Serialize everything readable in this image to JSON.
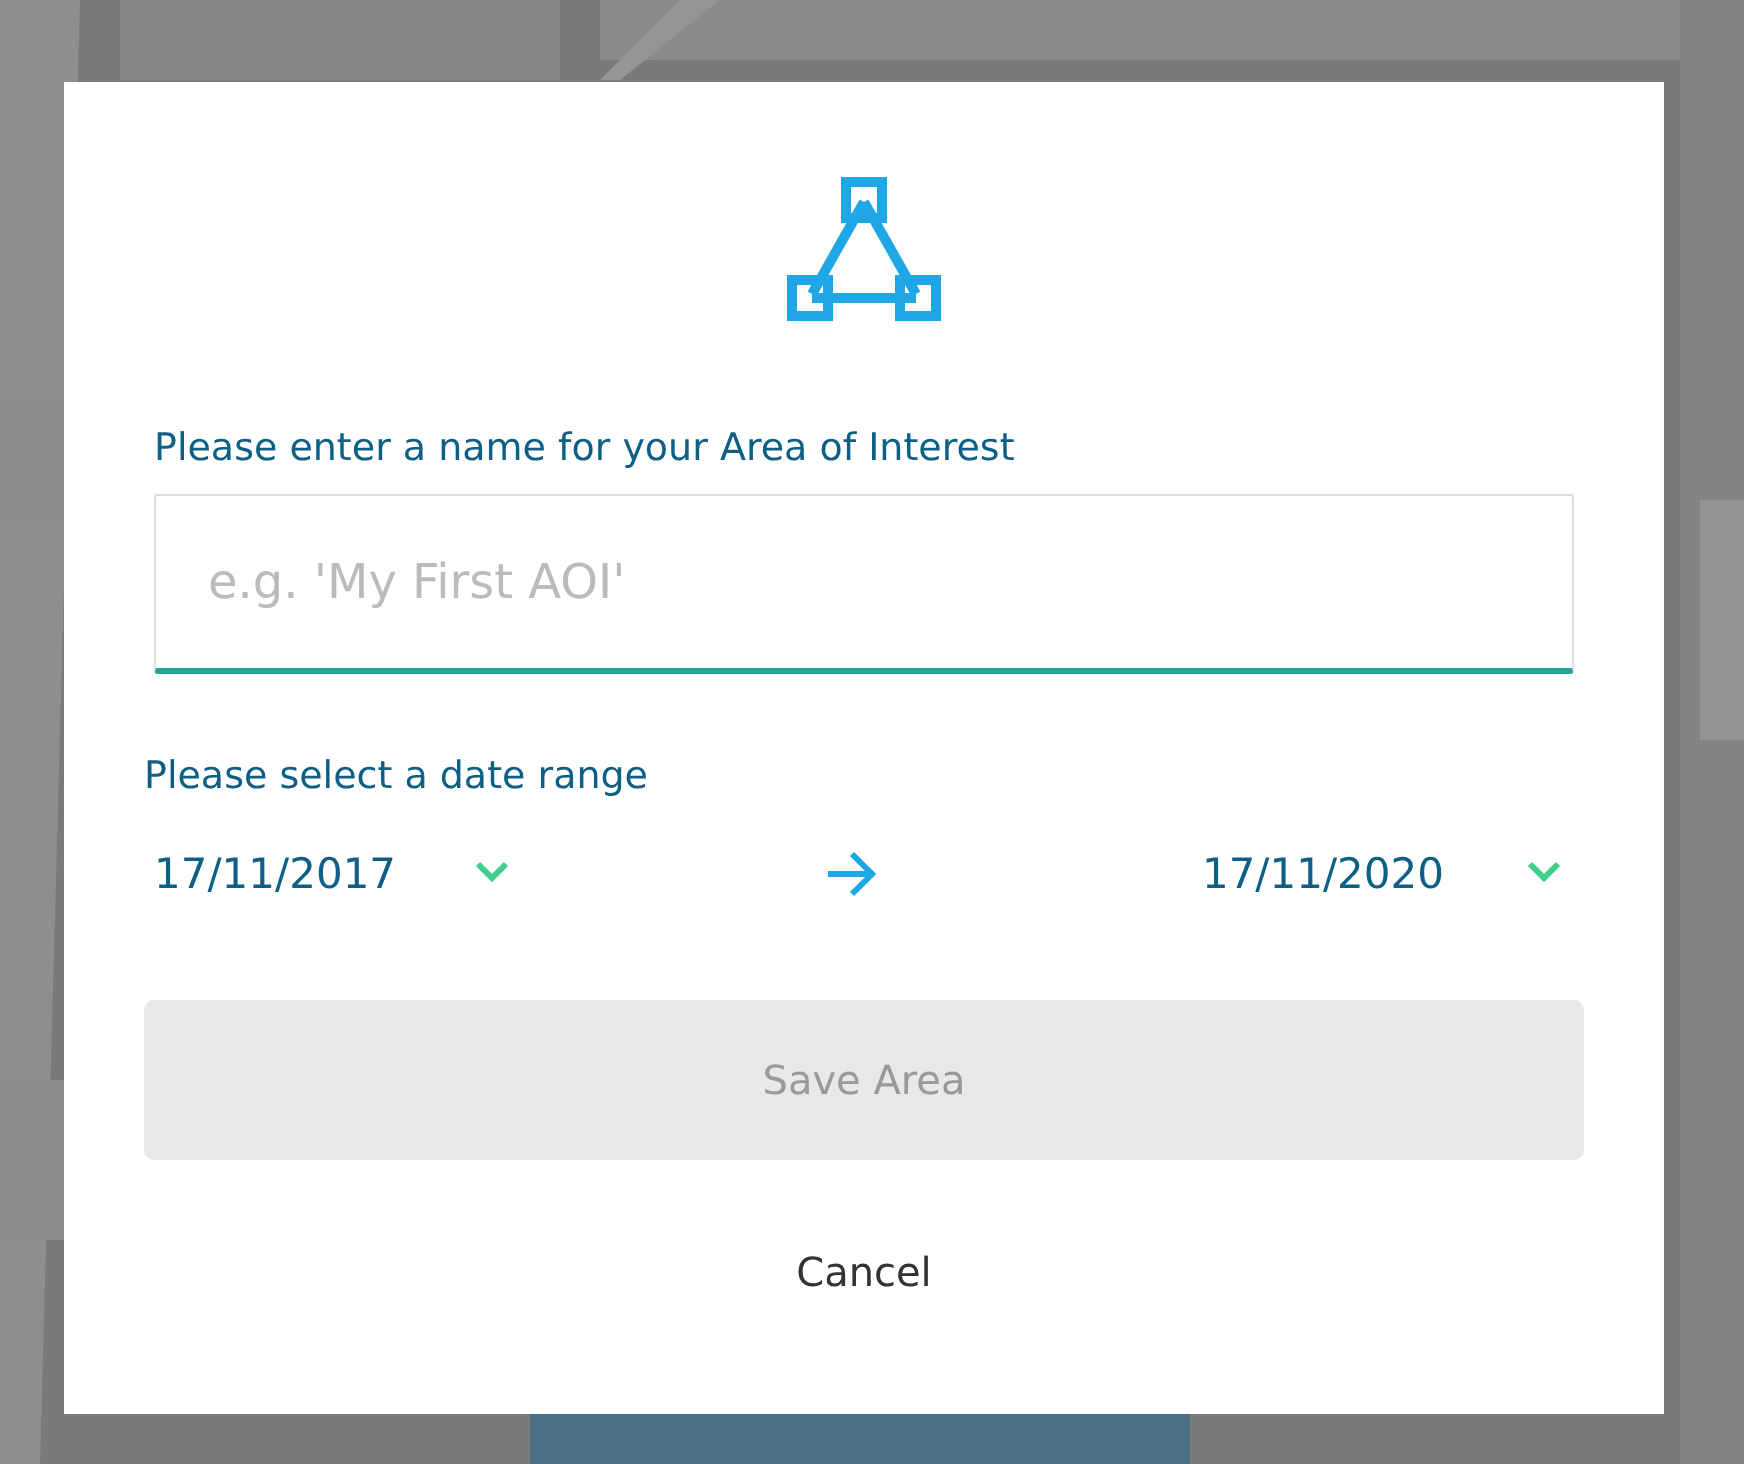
{
  "dialog": {
    "name_label": "Please enter a name for your Area of Interest",
    "name_field": {
      "placeholder": "e.g. 'My First AOI'"
    },
    "date_label": "Please select a date range",
    "start_date": "17/11/2017",
    "end_date": "17/11/2020",
    "save_button": {
      "label": "Save Area",
      "disabled": true
    },
    "cancel_button": "Cancel"
  }
}
